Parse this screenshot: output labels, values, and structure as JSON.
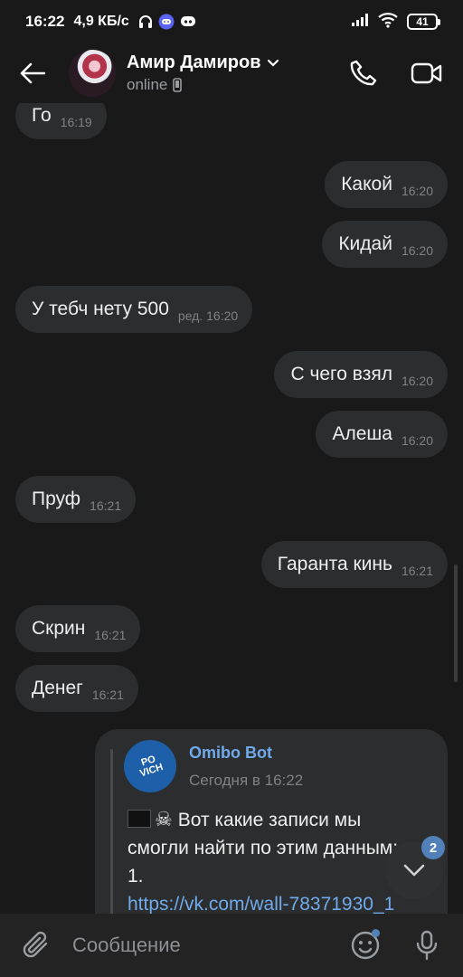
{
  "status_bar": {
    "time": "16:22",
    "speed": "4,9 КБ/с",
    "battery": "41"
  },
  "header": {
    "contact_name": "Амир Дамиров",
    "status": "online"
  },
  "messages": [
    {
      "dir": "in",
      "text": "Го",
      "time": "16:19"
    },
    {
      "dir": "out",
      "text": "Какой",
      "time": "16:20"
    },
    {
      "dir": "out",
      "text": "Кидай",
      "time": "16:20"
    },
    {
      "dir": "in",
      "text": "У тебч нету 500",
      "time": "ред. 16:20"
    },
    {
      "dir": "out",
      "text": "С чего взял",
      "time": "16:20"
    },
    {
      "dir": "out",
      "text": "Алеша",
      "time": "16:20"
    },
    {
      "dir": "in",
      "text": "Пруф",
      "time": "16:21"
    },
    {
      "dir": "out",
      "text": "Гаранта кинь",
      "time": "16:21"
    },
    {
      "dir": "in",
      "text": "Скрин",
      "time": "16:21"
    },
    {
      "dir": "in",
      "text": "Денег",
      "time": "16:21"
    }
  ],
  "bot_message": {
    "name": "Omibo Bot",
    "date": "Сегодня в 16:22",
    "avatar_text_1": "PO",
    "avatar_text_2": "VICH",
    "text_line_1": "Вот какие записи мы",
    "text_line_2": "смогли найти по этим данным:",
    "text_line_3": "1.",
    "link": "https://vk.com/wall-78371930_1"
  },
  "scroll_fab": {
    "badge": "2"
  },
  "composer": {
    "placeholder": "Сообщение"
  },
  "colors": {
    "accent": "#71aaeb",
    "bubble": "#2c2d2e",
    "background": "#191919",
    "badge": "#5181b8"
  }
}
